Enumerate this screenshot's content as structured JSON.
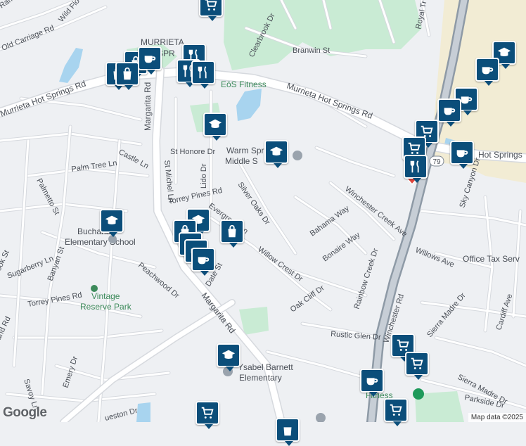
{
  "map": {
    "attribution": "Map data ©2025",
    "logo": "Google",
    "colors": {
      "background": "#eef0f3",
      "road": "#ffffff",
      "park": "#c9ebd4",
      "water": "#a8d4ef",
      "commercial": "#f2ecd4",
      "pin": "#0b4e7a",
      "highway": "#8e9aa6"
    },
    "labels": {
      "street": {
        "ramsho": "Ramsho",
        "old_carriage": "Old Carriage Rd",
        "wild_flo": "Wild Flo",
        "clearbrook": "Clearbrook Dr",
        "branwin": "Branwin St",
        "murrieta_hs_1": "Murrieta Hot Springs Rd",
        "murrieta_hs_2": "Murrieta Hot Springs Rd",
        "murrieta_hs_3": "Hot Springs",
        "margarita_1": "Margarita Rd",
        "margarita_2": "Margarita Rd",
        "st_honore": "St Honore Dr",
        "lido": "Lido Dr",
        "castle": "Castle Ln",
        "palm_tree": "Palm Tree Ln",
        "st_michel": "St Michel Ln",
        "palmetto": "Palmetto St",
        "torrey_1": "Torrey Pines Rd",
        "torrey_2": "Torrey Pines Rd",
        "evergreen": "Evergreen Ln",
        "silver_oaks": "Silver Oaks Dr",
        "willow_crest": "Willow Crest Dr",
        "bahama": "Bahama Way",
        "bonaire": "Bonaire Way",
        "winchester_creek": "Winchester Creek Ave",
        "willows": "Willows Ave",
        "sky_canyon": "Sky Canyon Dr",
        "sugarberry": "Sugarberry Ln",
        "banyan": "Banyan St",
        "peachwood": "Peachwood Dr",
        "date": "Date St",
        "oak_cliff": "Oak Cliff Dr",
        "rainbow_creek": "Rainbow Creek Dr",
        "winchester": "Winchester Rd",
        "rustic_glen": "Rustic Glen Dr",
        "sierra_madre_1": "Sierra Madre Dr",
        "sierra_madre_2": "Sierra Madre Dr",
        "cardiff": "Cardiff Ave",
        "parkside": "Parkside Dr",
        "emery": "Emery Dr",
        "savoy": "Savoy Ln",
        "royal": "Royal Tr",
        "ook": "ook St",
        "and": "and Rd",
        "ueston": "ueston Dr",
        "route": "79"
      },
      "poi": {
        "murrieta_springs_1": "MURRIETA",
        "murrieta_springs_2": "SPR",
        "eos_fitness": "EōS Fitness",
        "warm_springs_1": "Warm Spr",
        "warm_springs_2": "Middle S",
        "buchanan_1": "Buchanan",
        "buchanan_2": "Elementary School",
        "vintage_1": "Vintage",
        "vintage_2": "Reserve Park",
        "ysabel_1": "Ysabel Barnett",
        "ysabel_2": "Elementary",
        "office_tax": "Office Tax Serv",
        "fitness_bottom": "Fitness"
      }
    }
  }
}
